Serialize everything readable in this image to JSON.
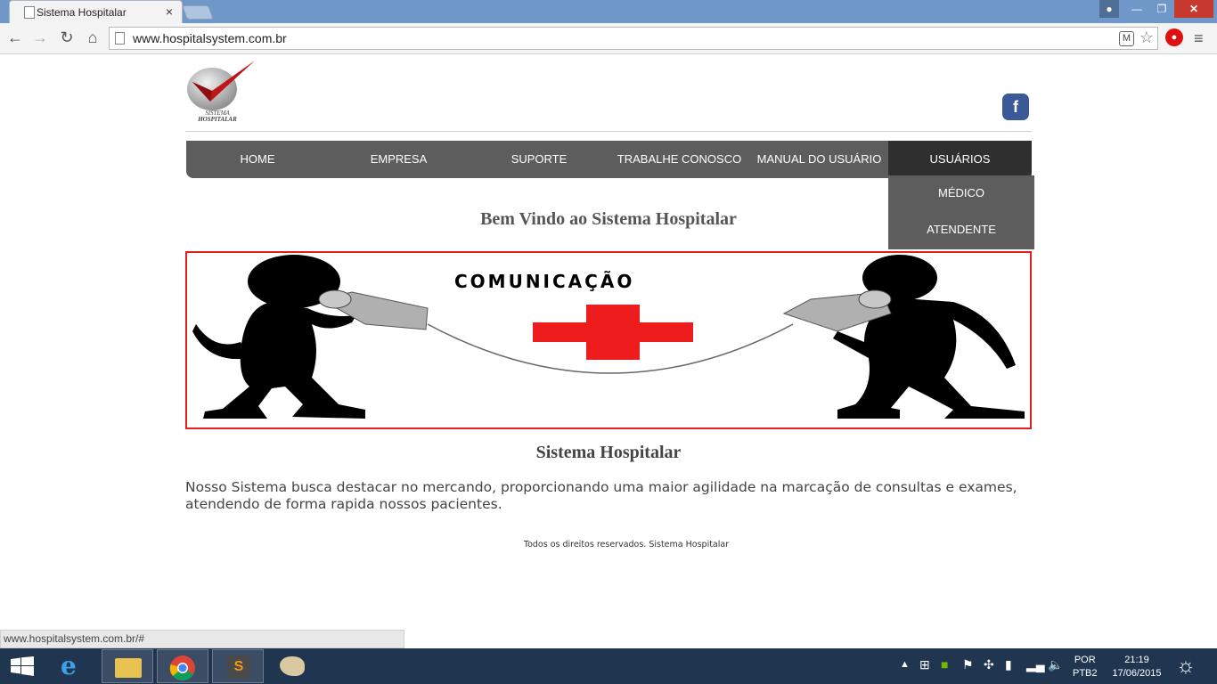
{
  "browser": {
    "tab_title": "Sistema Hospitalar",
    "tab_close": "×",
    "url": "www.hospitalsystem.com.br",
    "status_url": "www.hospitalsystem.com.br/#"
  },
  "header": {
    "logo_text_line1": "SISTEMA",
    "logo_text_line2": "HOSPITALAR",
    "facebook_label": "f"
  },
  "nav": {
    "items": [
      {
        "label": "HOME"
      },
      {
        "label": "EMPRESA"
      },
      {
        "label": "SUPORTE"
      },
      {
        "label": "TRABALHE CONOSCO"
      },
      {
        "label": "MANUAL DO USUÁRIO"
      },
      {
        "label": "USUÁRIOS"
      }
    ],
    "dropdown": [
      {
        "label": "MÉDICO"
      },
      {
        "label": "ATENDENTE"
      }
    ]
  },
  "main": {
    "welcome": "Bem Vindo ao Sistema Hospitalar",
    "banner_title": "COMUNICAÇÃO",
    "subtitle": "Sistema Hospitalar",
    "description": "Nosso Sistema busca destacar no mercando, proporcionando uma maior agilidade na marcação de consultas e exames, atendendo de forma rapida nossos pacientes."
  },
  "footer": {
    "text": "Todos os direitos reservados. Sistema Hospitalar"
  },
  "taskbar": {
    "language_line1": "POR",
    "language_line2": "PTB2",
    "time": "21:19",
    "date": "17/06/2015"
  },
  "colors": {
    "nav_bg": "#5d5d5d",
    "nav_active": "#2f2f2f",
    "banner_border": "#e02020",
    "cross_red": "#ee1c1c",
    "facebook": "#3b5998"
  }
}
